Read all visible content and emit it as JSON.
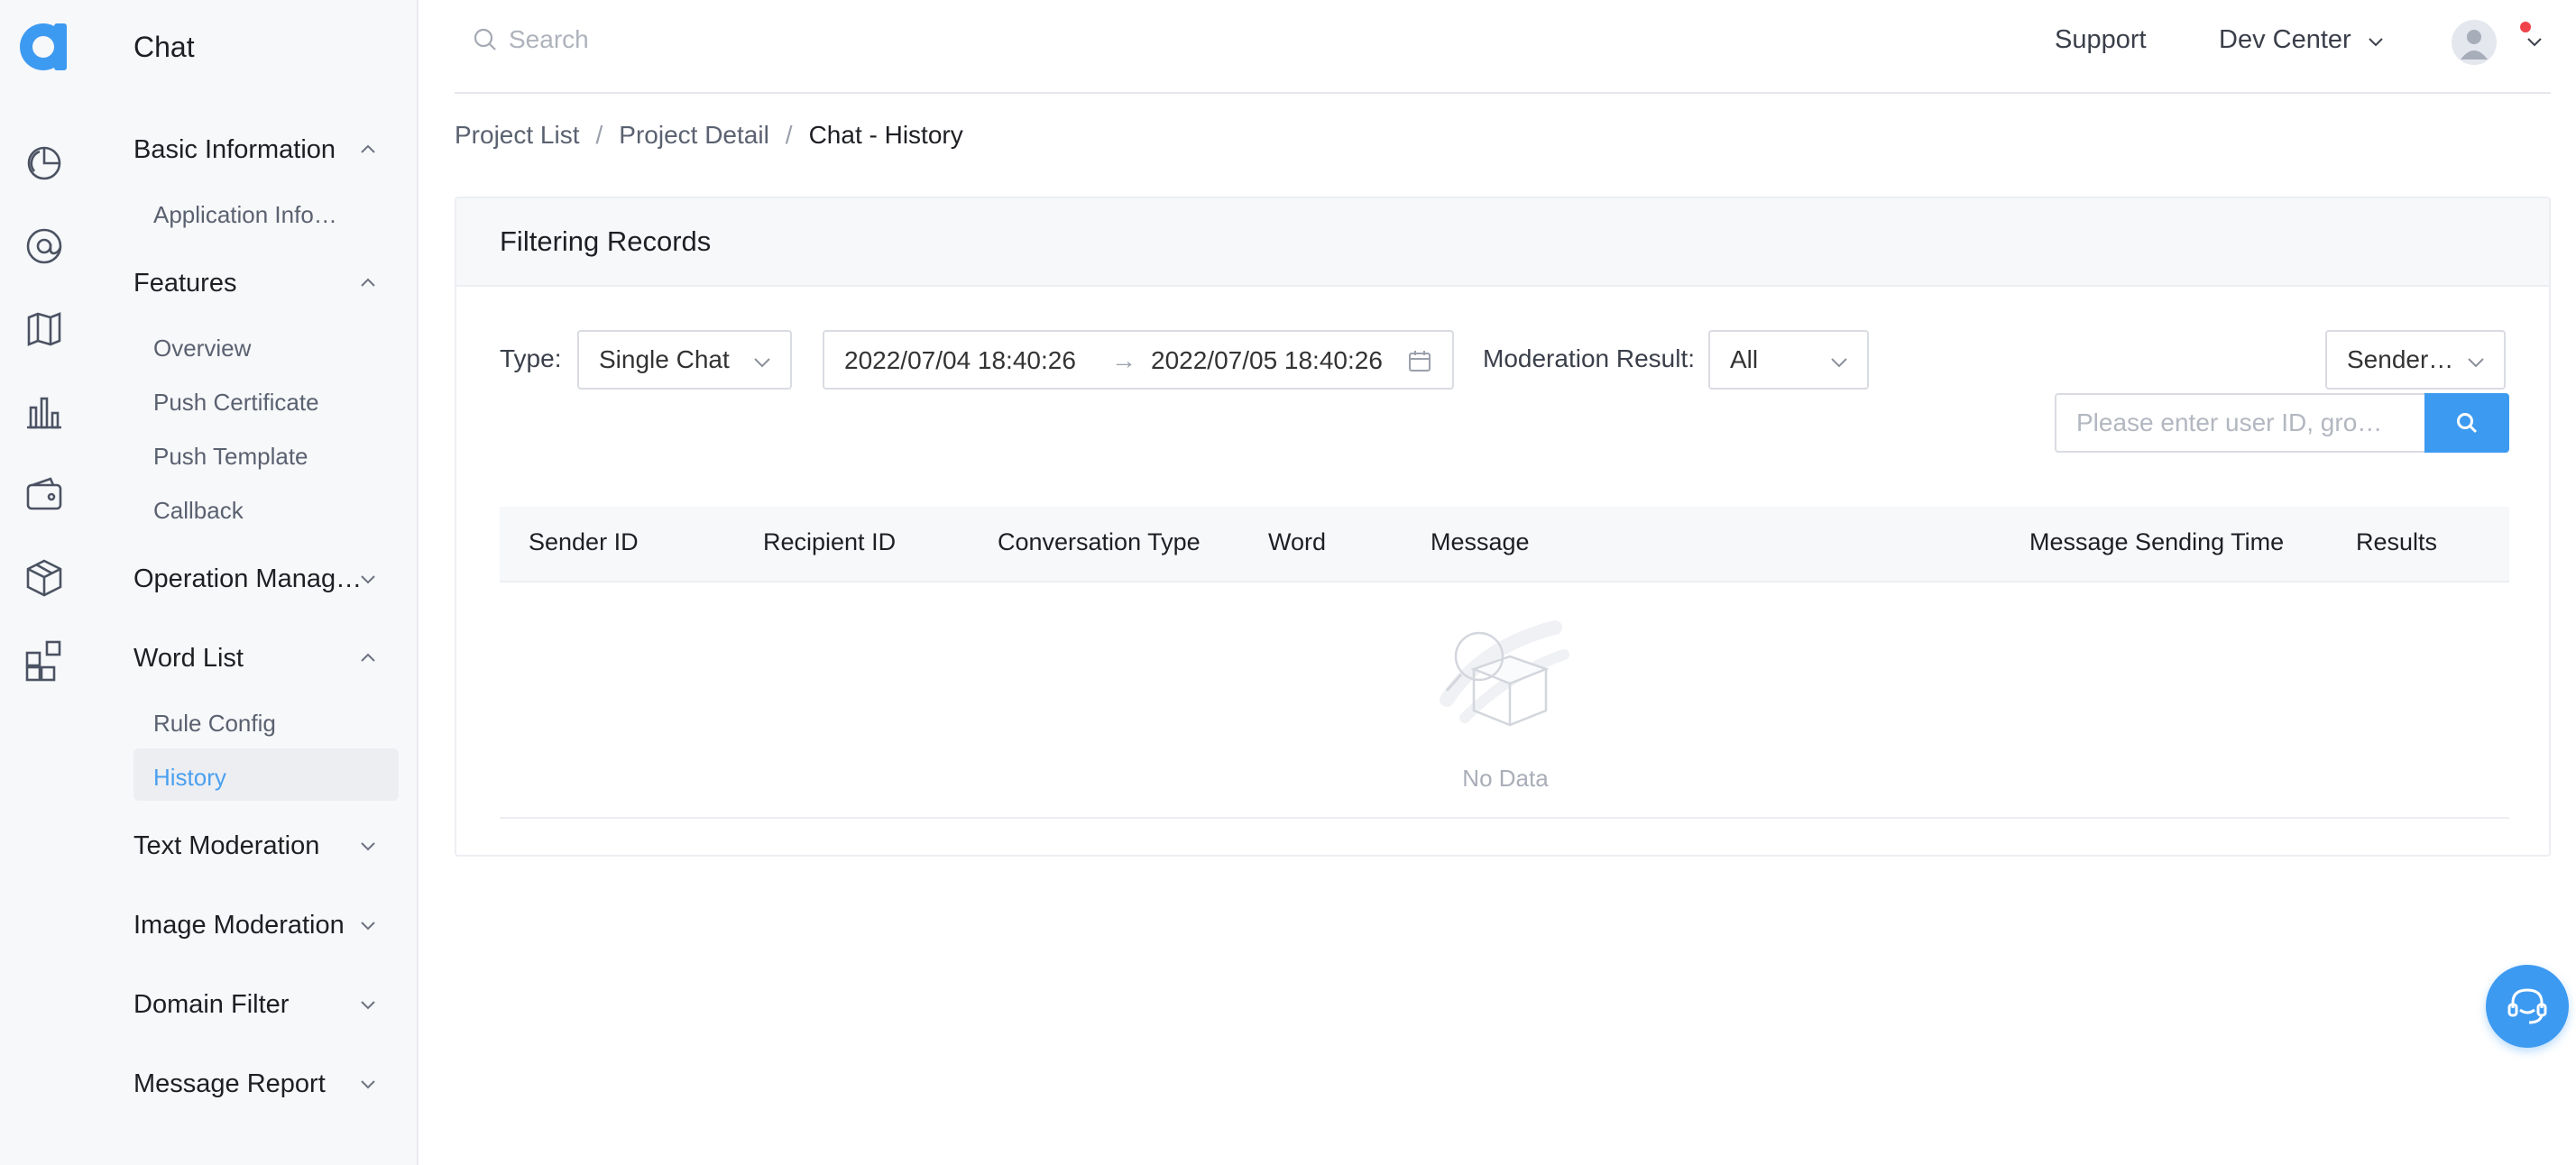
{
  "sidebar": {
    "title": "Chat",
    "groups": {
      "basic": "Basic Information",
      "features": "Features",
      "operation": "Operation Manag…",
      "wordlist": "Word List",
      "text": "Text Moderation",
      "image": "Image Moderation",
      "domain": "Domain Filter",
      "report": "Message Report"
    },
    "items": {
      "appinfo": "Application Info…",
      "overview": "Overview",
      "pushcert": "Push Certificate",
      "pushtpl": "Push Template",
      "callback": "Callback",
      "ruleconfig": "Rule Config",
      "history": "History"
    }
  },
  "header": {
    "search_placeholder": "Search",
    "support": "Support",
    "devcenter": "Dev Center"
  },
  "breadcrumb": {
    "project_list": "Project List",
    "project_detail": "Project Detail",
    "current": "Chat - History",
    "sep": "/"
  },
  "filter": {
    "title": "Filtering Records",
    "type_label": "Type",
    "colon": ":",
    "type_value": "Single Chat",
    "date_start": "2022/07/04 18:40:26",
    "date_arrow": "→",
    "date_end": "2022/07/05 18:40:26",
    "moderation_label": "Moderation Result",
    "moderation_value": "All",
    "sender_value": "Sender…",
    "uid_placeholder": "Please enter user ID, gro…"
  },
  "table": {
    "columns": [
      "Sender ID",
      "Recipient ID",
      "Conversation Type",
      "Word",
      "Message",
      "Message Sending Time",
      "Results"
    ],
    "empty": "No Data"
  },
  "colors": {
    "accent": "#3d9af1",
    "active_text": "#4a9ff0",
    "notification": "#f0424b"
  }
}
